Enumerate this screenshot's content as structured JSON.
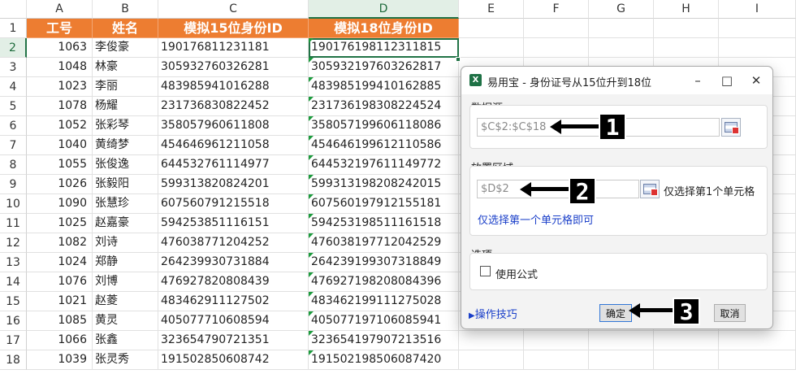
{
  "columns": [
    "A",
    "B",
    "C",
    "D",
    "E",
    "F",
    "G",
    "H",
    "I"
  ],
  "rows": [
    "1",
    "2",
    "3",
    "4",
    "5",
    "6",
    "7",
    "8",
    "9",
    "10",
    "11",
    "12",
    "13",
    "14",
    "15",
    "16",
    "17",
    "18"
  ],
  "headers": [
    "工号",
    "姓名",
    "模拟15位身份ID",
    "模拟18位身份ID"
  ],
  "data": [
    [
      "1063",
      "李俊豪",
      "190176811231181",
      "190176198112311815"
    ],
    [
      "1048",
      "林豪",
      "305932760326281",
      "305932197603262817"
    ],
    [
      "1023",
      "李丽",
      "483985941016288",
      "483985199410162885"
    ],
    [
      "1078",
      "杨耀",
      "231736830822452",
      "231736198308224524"
    ],
    [
      "1052",
      "张彩琴",
      "358057960611808",
      "358057199606118086"
    ],
    [
      "1040",
      "黄绮梦",
      "454646961211058",
      "454646199612110586"
    ],
    [
      "1055",
      "张俊逸",
      "644532761114977",
      "644532197611149772"
    ],
    [
      "1026",
      "张毅阳",
      "599313820824201",
      "599313198208242015"
    ],
    [
      "1090",
      "张慧珍",
      "607560791215518",
      "607560197912155181"
    ],
    [
      "1025",
      "赵嘉豪",
      "594253851116151",
      "594253198511161518"
    ],
    [
      "1082",
      "刘诗",
      "476038771204252",
      "476038197712042529"
    ],
    [
      "1024",
      "郑静",
      "264239930731884",
      "264239199307318849"
    ],
    [
      "1076",
      "刘博",
      "476927820808439",
      "476927198208084396"
    ],
    [
      "1021",
      "赵菱",
      "483462911127502",
      "483462199111275028"
    ],
    [
      "1085",
      "黄灵",
      "405077710608594",
      "405077197106085941"
    ],
    [
      "1066",
      "张鑫",
      "323654790721351",
      "323654197907213516"
    ],
    [
      "1039",
      "张灵秀",
      "191502850608742",
      "191502198506087420"
    ]
  ],
  "dialog": {
    "app_icon": "X",
    "title": "易用宝 - 身份证号从15位升到18位",
    "minimize": "–",
    "maximize": "□",
    "close": "✕",
    "data_source_label": "数据源",
    "data_source_value": "$C$2:$C$18",
    "placement_label": "放置区域",
    "placement_value": "$D$2",
    "placement_hint": "仅选择第1个单元格",
    "placement_link": "仅选择第一个单元格即可",
    "options_label": "选项",
    "use_formula_label": "使用公式",
    "tips_arrow": "▶",
    "tips_label": "操作技巧",
    "ok_label": "确定",
    "cancel_label": "取消"
  },
  "annotations": {
    "badge1": "1",
    "badge2": "2",
    "badge3": "3"
  },
  "colors": {
    "header_fill": "#ed7d31",
    "excel_green": "#217346",
    "link_blue": "#1a3fc9"
  }
}
